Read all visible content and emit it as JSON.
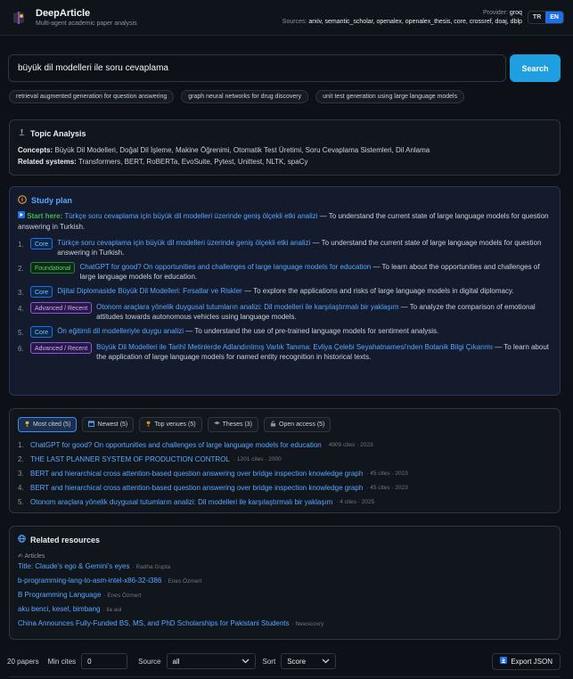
{
  "header": {
    "title": "DeepArticle",
    "subtitle": "Multi-agent academic paper analysis",
    "provider_label": "Provider:",
    "provider_value": "groq",
    "sources_label": "Sources:",
    "sources_value": "arxiv, semantic_scholar, openalex, openalex_thesis, core, crossref, doaj, dblp",
    "lang_tr": "TR",
    "lang_en": "EN"
  },
  "search": {
    "value": "büyük dil modelleri ile soru cevaplama",
    "button": "Search",
    "suggestions": [
      "retrieval augmented generation for question answering",
      "graph neural networks for drug discovery",
      "unit test generation using large language models"
    ]
  },
  "topic": {
    "title": "Topic Analysis",
    "concepts_label": "Concepts:",
    "concepts": "Büyük Dil Modelleri, Doğal Dil İşleme, Makine Öğrenimi, Otomatik Test Üretimi, Soru Cevaplama Sistemleri, Dil Anlama",
    "systems_label": "Related systems:",
    "systems": "Transformers, BERT, RoBERTa, EvoSuite, Pytest, Unittest, NLTK, spaCy"
  },
  "study": {
    "title": "Study plan",
    "start_label": "Start here:",
    "start_title": "Türkçe soru cevaplama için büyük dil modelleri üzerinde geniş ölçekli etki analizi",
    "start_desc": " — To understand the current state of large language models for question answering in Turkish.",
    "items": [
      {
        "num": "1.",
        "badge": "Core",
        "title": "Türkçe soru cevaplama için büyük dil modelleri üzerinde geniş ölçekli etki analizi",
        "desc": " — To understand the current state of large language models for question answering in Turkish."
      },
      {
        "num": "2.",
        "badge": "Foundational",
        "title": "ChatGPT for good? On opportunities and challenges of large language models for education",
        "desc": " — To learn about the opportunities and challenges of large language models for education."
      },
      {
        "num": "3.",
        "badge": "Core",
        "title": "Dijital Diplomaside Büyük Dil Modelleri: Fırsatlar ve Riskler",
        "desc": " — To explore the applications and risks of large language models in digital diplomacy."
      },
      {
        "num": "4.",
        "badge": "Advanced / Recent",
        "title": "Otonom araçlara yönelik duygusal tutumların analizi: Dil modelleri ile karşılaştırmalı bir yaklaşım",
        "desc": " — To analyze the comparison of emotional attitudes towards autonomous vehicles using language models."
      },
      {
        "num": "5.",
        "badge": "Core",
        "title": "Ön eğitimli dil modelleriyle duygu analizi",
        "desc": " — To understand the use of pre-trained language models for sentiment analysis."
      },
      {
        "num": "6.",
        "badge": "Advanced / Recent",
        "title": "Büyük Dil Modelleri ile Tarihî Metinlerde Adlandırılmış Varlık Tanıma: Evliya Çelebi Seyahatnamesi'nden Botanik Bilgi Çıkarımı",
        "desc": " — To learn about the application of large language models for named entity recognition in historical texts."
      }
    ]
  },
  "papers": {
    "tabs": [
      "Most cited (5)",
      "Newest (5)",
      "Top venues (5)",
      "Theses (3)",
      "Open access (5)"
    ],
    "items": [
      {
        "num": "1.",
        "title": "ChatGPT for good? On opportunities and challenges of large language models for education",
        "meta": "· 4909 cites · 2023"
      },
      {
        "num": "2.",
        "title": "THE LAST PLANNER SYSTEM OF PRODUCTION CONTROL",
        "meta": "· 1201 cites · 2000"
      },
      {
        "num": "3.",
        "title": "BERT and hierarchical cross attention-based question answering over bridge inspection knowledge graph",
        "meta": "· 45 cites · 2023"
      },
      {
        "num": "4.",
        "title": "BERT and hierarchical cross attention-based question answering over bridge inspection knowledge graph",
        "meta": "· 45 cites · 2023"
      },
      {
        "num": "5.",
        "title": "Otonom araçlara yönelik duygusal tutumların analizi: Dil modelleri ile karşılaştırmalı bir yaklaşım",
        "meta": "· 4 cites · 2025"
      }
    ]
  },
  "related": {
    "title": "Related resources",
    "section": "Articles",
    "items": [
      {
        "title": "Title: Claude's ego & Gemini's eyes",
        "by": "· Radha Gupta"
      },
      {
        "title": "b-programming-lang-to-asm-intel-x86-32-i386",
        "by": "· Enes Özmert"
      },
      {
        "title": "B Programming Language",
        "by": "· Enes Özmert"
      },
      {
        "title": "aku benci, kesel, bimbang",
        "by": "· lia aul"
      },
      {
        "title": "China Announces Fully-Funded BS, MS, and PhD Scholarships for Pakistani Students",
        "by": "· Newscovry"
      }
    ]
  },
  "controls": {
    "count": "20 papers",
    "min_cites_label": "Min cites",
    "min_cites_value": "0",
    "source_label": "Source",
    "source_value": "all",
    "sort_label": "Sort",
    "sort_value": "Score",
    "export": "Export JSON"
  }
}
